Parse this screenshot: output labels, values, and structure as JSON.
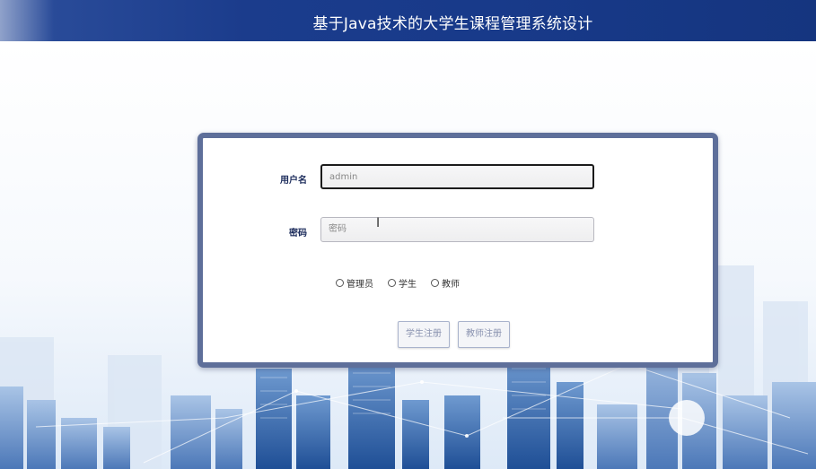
{
  "header": {
    "title": "基于Java技术的大学生课程管理系统设计"
  },
  "login": {
    "username_label": "用户名",
    "username_value": "admin",
    "password_label": "密码",
    "password_placeholder": "密码",
    "roles": [
      {
        "label": "管理员",
        "selected": false
      },
      {
        "label": "学生",
        "selected": false
      },
      {
        "label": "教师",
        "selected": false
      }
    ],
    "student_register_label": "学生注册",
    "teacher_register_label": "教师注册"
  },
  "colors": {
    "header_bg": "#183a8a",
    "card_border": "#5e6f9a",
    "label_text": "#1a2a5a"
  }
}
